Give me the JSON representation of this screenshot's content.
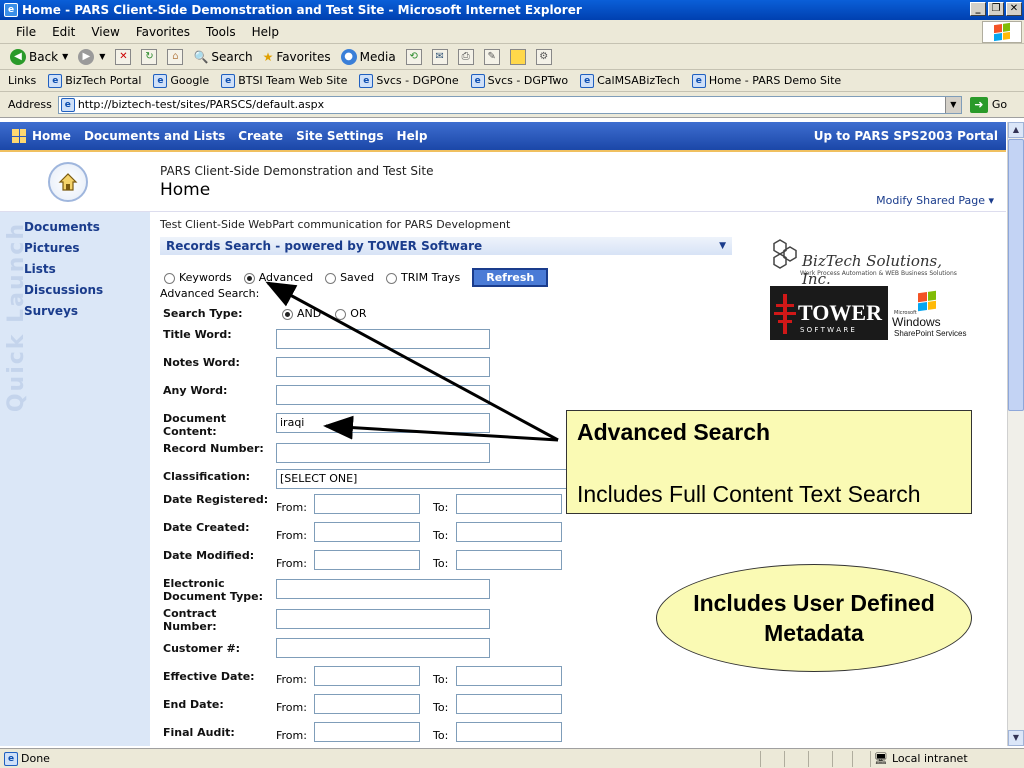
{
  "window": {
    "title": "Home - PARS Client-Side Demonstration and Test Site - Microsoft Internet Explorer",
    "min": "_",
    "max": "❐",
    "close": "✕"
  },
  "menu": {
    "items": [
      "File",
      "Edit",
      "View",
      "Favorites",
      "Tools",
      "Help"
    ]
  },
  "toolbar": {
    "back": "Back",
    "search": "Search",
    "favorites": "Favorites",
    "media": "Media"
  },
  "links": {
    "label": "Links",
    "items": [
      "BizTech Portal",
      "Google",
      "BTSI Team Web Site",
      "Svcs - DGPOne",
      "Svcs - DGPTwo",
      "CalMSABizTech",
      "Home - PARS Demo Site"
    ]
  },
  "address": {
    "label": "Address",
    "url": "http://biztech-test/sites/PARSCS/default.aspx",
    "go": "Go"
  },
  "sp_nav": {
    "items": [
      "Home",
      "Documents and Lists",
      "Create",
      "Site Settings",
      "Help"
    ],
    "portal_link": "Up to PARS SPS2003 Portal"
  },
  "header": {
    "site_title": "PARS Client-Side Demonstration and Test Site",
    "page_title": "Home",
    "modify": "Modify Shared Page ▾"
  },
  "quick_launch": {
    "watermark": "Quick Launch",
    "items": [
      "Documents",
      "Pictures",
      "Lists",
      "Discussions",
      "Surveys"
    ]
  },
  "webpart": {
    "description": "Test Client-Side WebPart communication for PARS Development",
    "title": "Records Search - powered by TOWER Software",
    "modes": [
      "Keywords",
      "Advanced",
      "Saved",
      "TRIM Trays"
    ],
    "selected_mode": "Advanced",
    "refresh": "Refresh",
    "advanced_label": "Advanced Search:",
    "search_type_label": "Search Type:",
    "search_type_options": [
      "AND",
      "OR"
    ],
    "search_type_selected": "AND",
    "fields": {
      "title_word": "Title Word:",
      "notes_word": "Notes Word:",
      "any_word": "Any Word:",
      "document_content_1": "Document",
      "document_content_2": "Content:",
      "document_content_value": "iraqi",
      "record_number": "Record Number:",
      "classification": "Classification:",
      "classification_value": "[SELECT ONE]",
      "date_registered": "Date Registered:",
      "date_created": "Date Created:",
      "date_modified": "Date Modified:",
      "edt_1": "Electronic",
      "edt_2": "Document Type:",
      "contract_1": "Contract",
      "contract_2": "Number:",
      "customer": "Customer #:",
      "effective_date": "Effective Date:",
      "end_date": "End Date:",
      "final_audit": "Final Audit:",
      "from": "From:",
      "to": "To:"
    }
  },
  "logos": {
    "biztech_name": "BizTech Solutions, Inc.",
    "biztech_tagline": "Work Process Automation & WEB Business Solutions",
    "tower_name": "TOWER",
    "tower_sub": "S O F T W A R E",
    "win_small": "Microsoft",
    "win_name": "Windows",
    "win_sub": "SharePoint Services"
  },
  "callouts": {
    "box_title": "Advanced Search",
    "box_sub": "Includes Full Content Text Search",
    "ellipse_line1": "Includes User Defined",
    "ellipse_line2": "Metadata"
  },
  "status": {
    "left": "Done",
    "zone": "Local intranet"
  }
}
